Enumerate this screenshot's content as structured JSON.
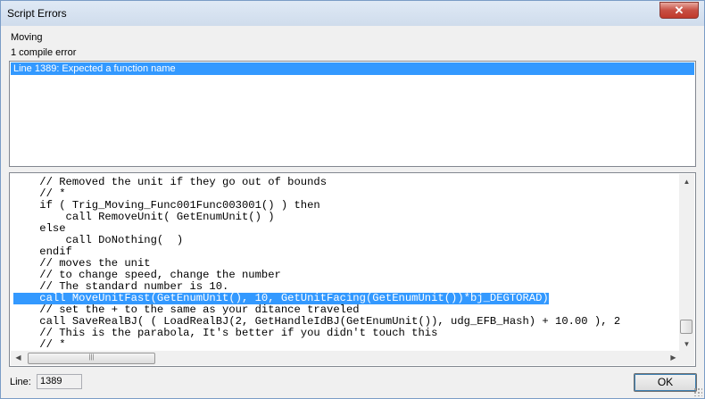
{
  "window": {
    "title": "Script Errors",
    "close_glyph": "✕"
  },
  "trigger_name": "Moving",
  "error_count": "1 compile error",
  "errors": [
    {
      "text": "Line 1389: Expected a function name",
      "selected": true
    }
  ],
  "code": {
    "lines": [
      "    // Removed the unit if they go out of bounds",
      "    // *",
      "    if ( Trig_Moving_Func001Func003001() ) then",
      "        call RemoveUnit( GetEnumUnit() )",
      "    else",
      "        call DoNothing(  )",
      "    endif",
      "    // moves the unit",
      "    // to change speed, change the number",
      "    // The standard number is 10.",
      "    call MoveUnitFast(GetEnumUnit(), 10, GetUnitFacing(GetEnumUnit())*bj_DEGTORAD)",
      "    // set the + to the same as your ditance traveled",
      "    call SaveRealBJ( ( LoadRealBJ(2, GetHandleIdBJ(GetEnumUnit()), udg_EFB_Hash) + 10.00 ), 2",
      "    // This is the parabola, It's better if you didn't touch this",
      "    // *"
    ],
    "highlighted_line_index": 10
  },
  "scrollbars": {
    "up_glyph": "▲",
    "down_glyph": "▼",
    "left_glyph": "◀",
    "right_glyph": "▶",
    "h_thumb_grip": "|||"
  },
  "footer": {
    "line_label": "Line:",
    "line_value": "1389",
    "ok_label": "OK"
  }
}
